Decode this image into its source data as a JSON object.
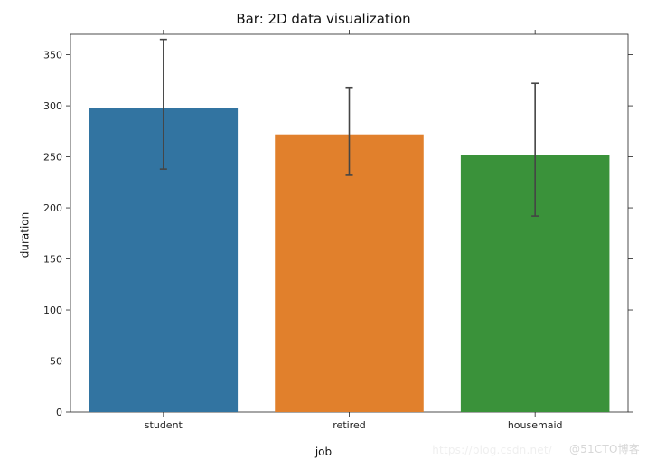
{
  "chart_data": {
    "type": "bar",
    "title": "Bar: 2D data visualization",
    "xlabel": "job",
    "ylabel": "duration",
    "ylim": [
      0,
      370
    ],
    "yticks": [
      0,
      50,
      100,
      150,
      200,
      250,
      300,
      350
    ],
    "categories": [
      "student",
      "retired",
      "housemaid"
    ],
    "values": [
      298,
      272,
      252
    ],
    "errors_low": [
      238,
      232,
      192
    ],
    "errors_high": [
      365,
      318,
      322
    ],
    "colors": [
      "#3274a1",
      "#e1802c",
      "#3a923a"
    ]
  },
  "watermark_primary": "@51CTO博客",
  "watermark_secondary": "https://blog.csdn.net/"
}
